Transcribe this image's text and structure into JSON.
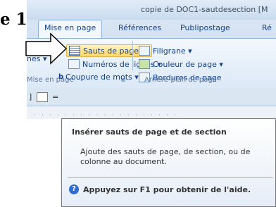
{
  "step_label": "e 1",
  "window": {
    "title": "copie de DOC1-sautdesection [M"
  },
  "tabs": [
    {
      "label": "Mise en page",
      "active": true
    },
    {
      "label": "Références"
    },
    {
      "label": "Publipostage"
    },
    {
      "label": "Ré"
    }
  ],
  "ribbon": {
    "left_group": {
      "cut_label": "nes ▾",
      "label": "Mise en page",
      "launcher_icon": "dialog-launcher-icon"
    },
    "page_setup": [
      {
        "label": "Sauts de pages ▾",
        "icon": "breaks-icon",
        "highlighted": true
      },
      {
        "label": "Numéros de lignes ▾",
        "icon": "line-numbers-icon"
      },
      {
        "label": "Coupure de mots ▾",
        "icon": "hyphenation-icon"
      }
    ],
    "background_group": {
      "label": "Arrière-plan de page",
      "items": [
        {
          "label": "Filigrane ▾",
          "icon": "watermark-icon"
        },
        {
          "label": "Couleur de page ▾",
          "icon": "page-color-icon"
        },
        {
          "label": "Bordures de page",
          "icon": "page-borders-icon"
        }
      ]
    }
  },
  "quick_access": {
    "icon": "qat-icon",
    "dropdown": "="
  },
  "tooltip": {
    "title": "Insérer sauts de page et de section",
    "body": "Ajoute des sauts de page, de section, ou de colonne au document.",
    "help_text": "Appuyez sur F1 pour obtenir de l'aide.",
    "help_icon": "help-icon"
  },
  "colors": {
    "ribbon": "#dbe8f6",
    "highlight": "#ffd86a",
    "tab_text": "#15428b"
  }
}
